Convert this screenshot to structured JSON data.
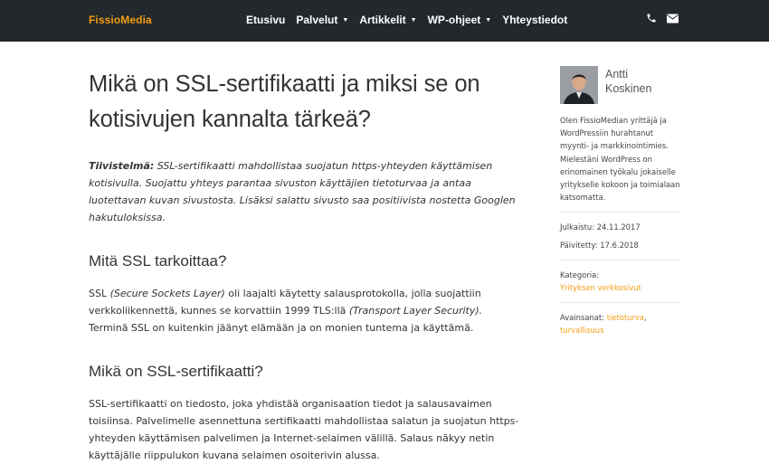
{
  "header": {
    "logo": "FissioMedia",
    "nav": [
      {
        "label": "Etusivu",
        "has_caret": false
      },
      {
        "label": "Palvelut",
        "has_caret": true
      },
      {
        "label": "Artikkelit",
        "has_caret": true
      },
      {
        "label": "WP-ohjeet",
        "has_caret": true
      },
      {
        "label": "Yhteystiedot",
        "has_caret": false
      }
    ],
    "icons": [
      "phone-icon",
      "envelope-icon"
    ],
    "caret_glyph": "▼"
  },
  "article": {
    "title": "Mikä on SSL-sertifikaatti ja miksi se on kotisivujen kannalta tärkeä?",
    "summary_label": "Tiivistelmä:",
    "summary_text": " SSL-sertifikaatti mahdollistaa suojatun https-yhteyden käyttämisen kotisivulla. Suojattu yhteys parantaa sivuston käyttäjien tietoturvaa ja antaa luotettavan kuvan sivustosta. Lisäksi salattu sivusto saa positiivista nostetta Googlen hakutuloksissa.",
    "heading1": "Mitä SSL tarkoittaa?",
    "para1": {
      "a": "SSL ",
      "b": "(Secure Sockets Layer)",
      "c": " oli laajalti käytetty salausprotokolla, jolla suojattiin verkkoliikennettä, kunnes se korvattiin 1999 TLS:llä ",
      "d": "(Transport Layer Security).",
      "e": " Terminä SSL on kuitenkin jäänyt elämään ja on monien tuntema ja käyttämä."
    },
    "heading2": "Mikä on SSL-sertifikaatti?",
    "para2": "SSL-sertifikaatti on tiedosto, joka yhdistää organisaation tiedot ja salausavaimen toisiinsa. Palvelimelle asennettuna sertifikaatti mahdollistaa salatun ja suojatun https-yhteyden käyttämisen palvelimen ja Internet-selaimen välillä. Salaus näkyy netin käyttäjälle riippulukon kuvana selaimen osoiterivin alussa."
  },
  "sidebar": {
    "author_first": "Antti",
    "author_last": "Koskinen",
    "bio": "Olen FissioMedian yrittäjä ja WordPressiin hurahtanut myynti- ja markkinointimies. Mielestäni WordPress on erinomainen työkalu jokaiselle yritykselle kokoon ja toimialaan katsomatta.",
    "published_label": "Julkaistu:",
    "published_date": "24.11.2017",
    "updated_label": "Päivitetty:",
    "updated_date": "17.6.2018",
    "category_label": "Kategoria:",
    "category": "Yrityksen verkkosivut",
    "tags_label": "Avainsanat:",
    "tag1": "tietoturva",
    "tag_sep": ",",
    "tag2": "turvallisuus"
  },
  "colors": {
    "accent": "#f39c12",
    "navbar": "#23282d",
    "text": "#333333"
  }
}
